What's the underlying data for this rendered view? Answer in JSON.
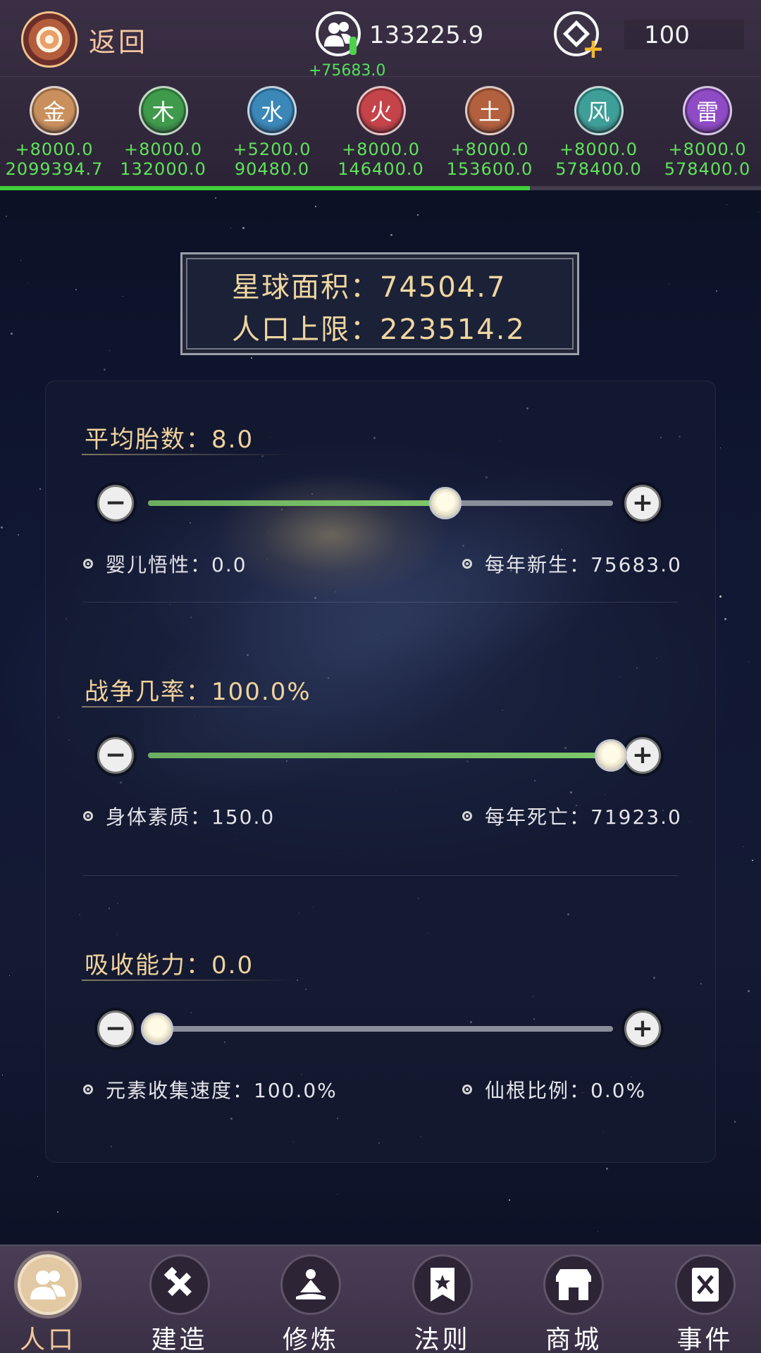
{
  "header": {
    "back_label": "返回",
    "population": "133225.9",
    "population_delta": "+75683.0",
    "currency": "100"
  },
  "elements": [
    {
      "name": "金",
      "rate": "+8000.0",
      "total": "2099394.7",
      "color": "#c9905e"
    },
    {
      "name": "木",
      "rate": "+8000.0",
      "total": "132000.0",
      "color": "#3f9a4c"
    },
    {
      "name": "水",
      "rate": "+5200.0",
      "total": "90480.0",
      "color": "#3a87b8"
    },
    {
      "name": "火",
      "rate": "+8000.0",
      "total": "146400.0",
      "color": "#c4444a"
    },
    {
      "name": "土",
      "rate": "+8000.0",
      "total": "153600.0",
      "color": "#b2603e"
    },
    {
      "name": "风",
      "rate": "+8000.0",
      "total": "578400.0",
      "color": "#3e9e98"
    },
    {
      "name": "雷",
      "rate": "+8000.0",
      "total": "578400.0",
      "color": "#8e4bc4"
    }
  ],
  "progress_fraction": 0.696,
  "planet": {
    "area_line": "星球面积：74504.7",
    "pop_limit_line": "人口上限：223514.2"
  },
  "sliders": [
    {
      "title": "平均胎数：8.0",
      "fill_fraction": 0.635,
      "stat_left": "婴儿悟性：0.0",
      "stat_right": "每年新生：75683.0"
    },
    {
      "title": "战争几率：100.0%",
      "fill_fraction": 1.0,
      "stat_left": "身体素质：150.0",
      "stat_right": "每年死亡：71923.0"
    },
    {
      "title": "吸收能力：0.0",
      "fill_fraction": 0.0,
      "stat_left": "元素收集速度：100.0%",
      "stat_right": "仙根比例：0.0%"
    }
  ],
  "nav": [
    {
      "label": "人口",
      "icon": "people-icon",
      "active": true
    },
    {
      "label": "建造",
      "icon": "hammer-wrench-icon",
      "active": false
    },
    {
      "label": "修炼",
      "icon": "meditation-icon",
      "active": false
    },
    {
      "label": "法则",
      "icon": "banner-star-icon",
      "active": false
    },
    {
      "label": "商城",
      "icon": "shop-icon",
      "active": false
    },
    {
      "label": "事件",
      "icon": "book-swords-icon",
      "active": false
    }
  ]
}
